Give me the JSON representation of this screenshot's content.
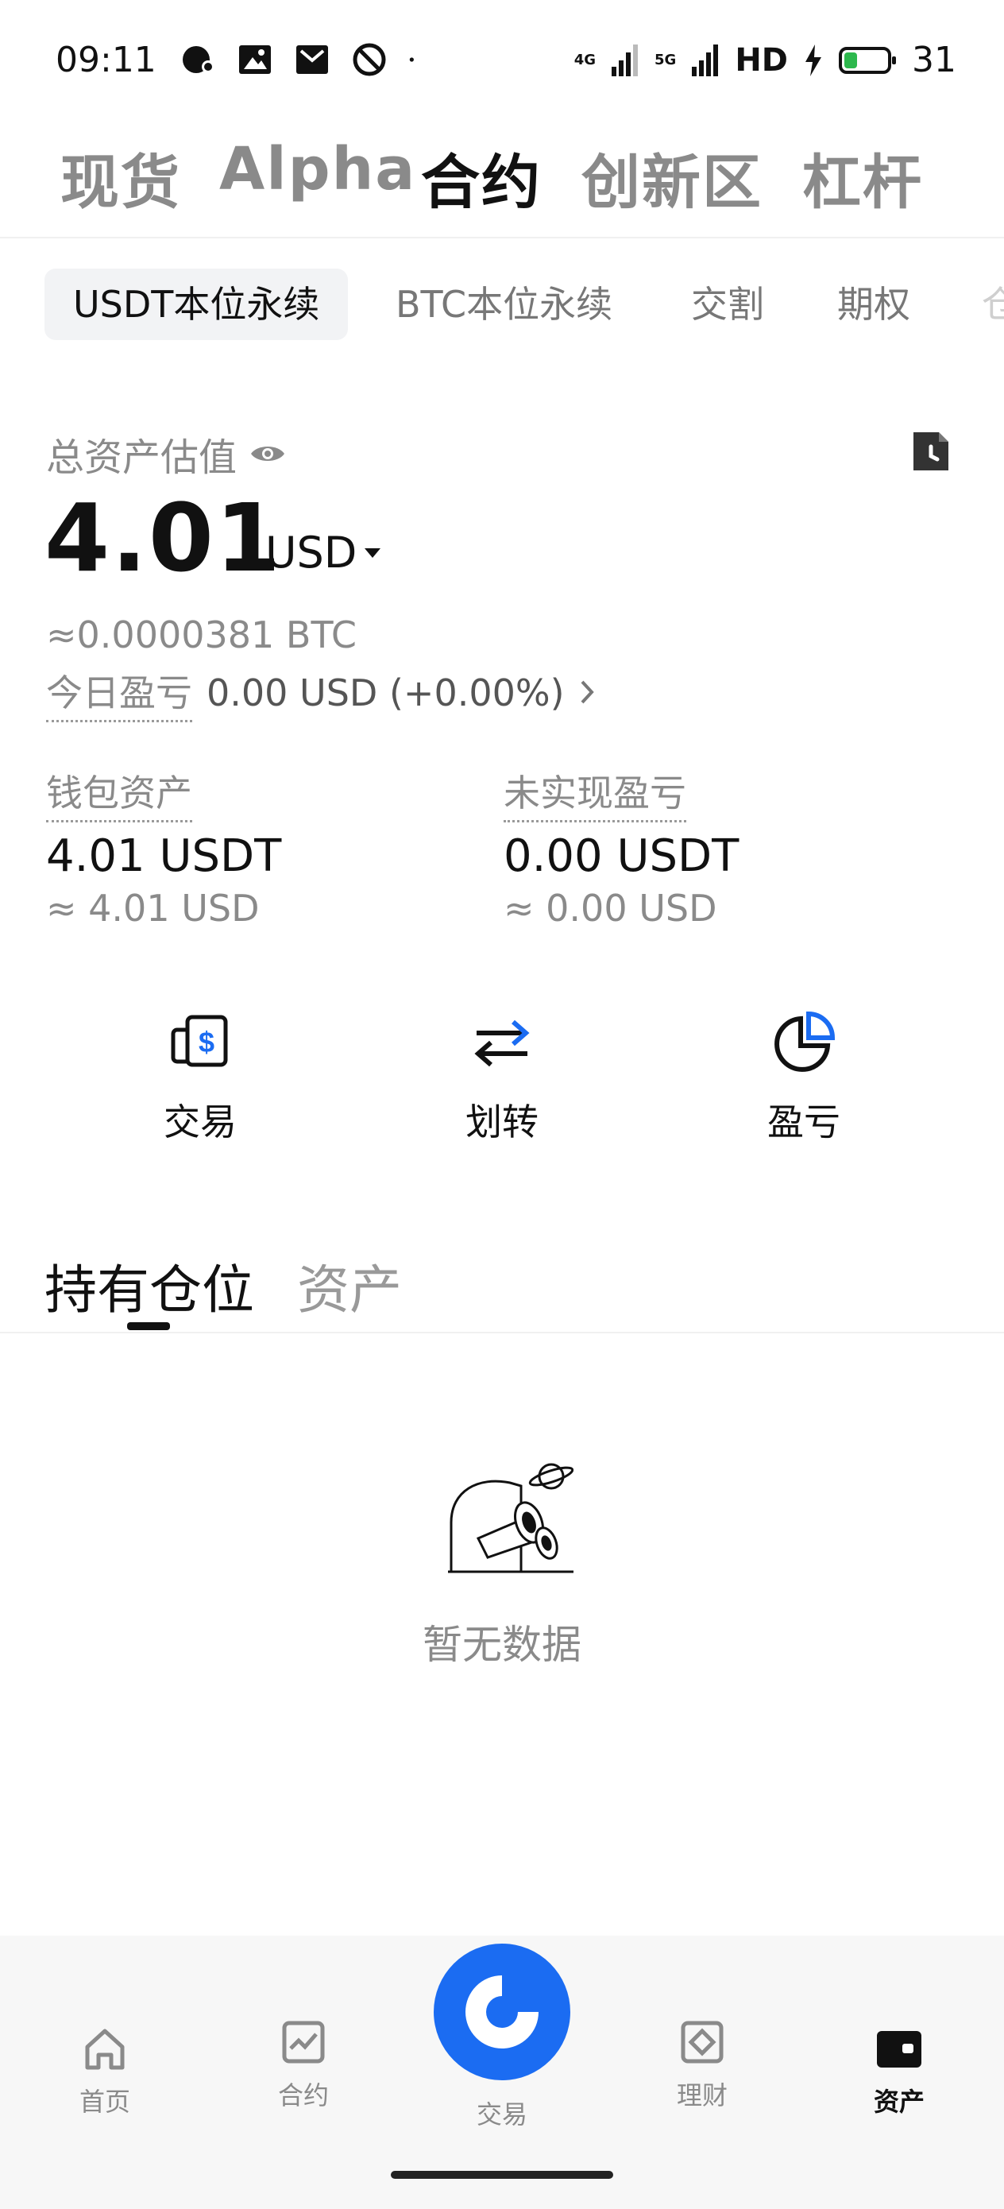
{
  "status_bar": {
    "time": "09:11",
    "network_1": "4G",
    "network_2": "5G",
    "hd_label": "HD",
    "battery": "31",
    "battery_level_pct": 31,
    "icons_left": [
      "paint-icon",
      "image-icon",
      "mail-icon",
      "block-icon",
      "dot-icon"
    ]
  },
  "top_tabs": [
    {
      "label": "现货",
      "active": false
    },
    {
      "label": "Alpha",
      "active": false
    },
    {
      "label": "合约",
      "active": true
    },
    {
      "label": "创新区",
      "active": false
    },
    {
      "label": "杠杆",
      "active": false
    }
  ],
  "sub_tabs": [
    {
      "label": "USDT本位永续",
      "active": true
    },
    {
      "label": "BTC本位永续",
      "active": false
    },
    {
      "label": "交割",
      "active": false
    },
    {
      "label": "期权",
      "active": false
    },
    {
      "label": "仓",
      "active": false
    }
  ],
  "assets": {
    "label": "总资产估值",
    "value": "4.01",
    "unit": "USD",
    "btc_equivalent": "≈0.0000381 BTC",
    "today_pnl_label": "今日盈亏",
    "today_pnl_value": "0.00 USD (+0.00%)",
    "wallet_label": "钱包资产",
    "wallet_value": "4.01 USDT",
    "wallet_approx": "≈ 4.01 USD",
    "unrealized_label": "未实现盈亏",
    "unrealized_value": "0.00 USDT",
    "unrealized_approx": "≈ 0.00 USD"
  },
  "actions": [
    {
      "label": "交易",
      "icon": "trade-icon"
    },
    {
      "label": "划转",
      "icon": "transfer-icon"
    },
    {
      "label": "盈亏",
      "icon": "pie-chart-icon"
    }
  ],
  "position_tabs": [
    {
      "label": "持有仓位",
      "active": true
    },
    {
      "label": "资产",
      "active": false
    }
  ],
  "empty_state": {
    "text": "暂无数据"
  },
  "bottom_nav": [
    {
      "label": "首页",
      "icon": "home-icon",
      "active": false
    },
    {
      "label": "合约",
      "icon": "futures-icon",
      "active": false
    },
    {
      "label": "交易",
      "icon": "trade-center-icon",
      "active": false
    },
    {
      "label": "理财",
      "icon": "earn-icon",
      "active": false
    },
    {
      "label": "资产",
      "icon": "wallet-icon",
      "active": true
    }
  ],
  "colors": {
    "accent": "#1b6cf2",
    "battery": "#2db84d",
    "text_primary": "#111111",
    "text_secondary": "#8a8a8a"
  }
}
